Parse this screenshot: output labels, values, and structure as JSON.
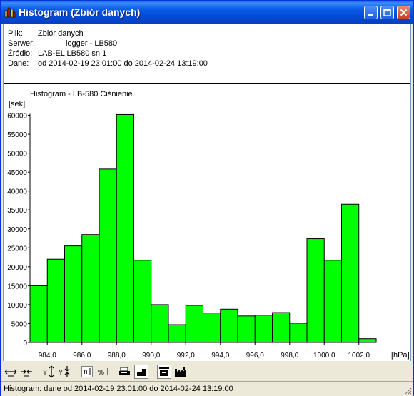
{
  "window": {
    "title": "Histogram (Zbiór danych)"
  },
  "info": {
    "file_label": "Plik:",
    "file_value": "Zbiór danych",
    "server_label": "Serwer:",
    "server_value": "logger - LB580",
    "source_label": "Źródło:",
    "source_value": "LAB-EL LB580  sn 1",
    "data_label": "Dane:",
    "data_value": "od 2014-02-19 23:01:00 do 2014-02-24 13:19:00"
  },
  "status": {
    "text": "Histogram: dane od 2014-02-19 23:01:00 do 2014-02-24 13:19:00"
  },
  "toolbar": {
    "icons": [
      "zoom-x-in-icon",
      "zoom-x-out-icon",
      "zoom-y-in-icon",
      "zoom-y-out-icon",
      "count-n-icon",
      "percent-icon",
      "print-icon",
      "bar-style-icon",
      "print-preview-icon",
      "factory-icon"
    ]
  },
  "colors": {
    "bar_fill": "#00ff00",
    "title_bar": "#0a5fe8"
  },
  "chart_data": {
    "type": "bar",
    "title": "Histogram - LB-580 Ciśnienie",
    "ylabel": "[sek]",
    "xlabel": "[hPa]",
    "ylim": [
      0,
      60000
    ],
    "xlim": [
      983,
      1003
    ],
    "bin_width": 1.0,
    "bin_starts": [
      983,
      984,
      985,
      986,
      987,
      988,
      989,
      990,
      991,
      992,
      993,
      994,
      995,
      996,
      997,
      998,
      999,
      1000,
      1001,
      1002
    ],
    "values": [
      15000,
      22000,
      25500,
      28500,
      45800,
      60200,
      21700,
      10000,
      4700,
      9800,
      7800,
      8800,
      7000,
      7200,
      7900,
      5100,
      27400,
      21700,
      36500,
      1000
    ],
    "xticks": [
      "984,0",
      "986,0",
      "988,0",
      "990,0",
      "992,0",
      "994,0",
      "996,0",
      "998,0",
      "1000,0",
      "1002,0"
    ],
    "xtick_values": [
      984,
      986,
      988,
      990,
      992,
      994,
      996,
      998,
      1000,
      1002
    ],
    "yticks": [
      "0",
      "5000",
      "10000",
      "15000",
      "20000",
      "25000",
      "30000",
      "35000",
      "40000",
      "45000",
      "50000",
      "55000",
      "60000"
    ],
    "ytick_values": [
      0,
      5000,
      10000,
      15000,
      20000,
      25000,
      30000,
      35000,
      40000,
      45000,
      50000,
      55000,
      60000
    ],
    "grid": false,
    "legend": "none"
  }
}
